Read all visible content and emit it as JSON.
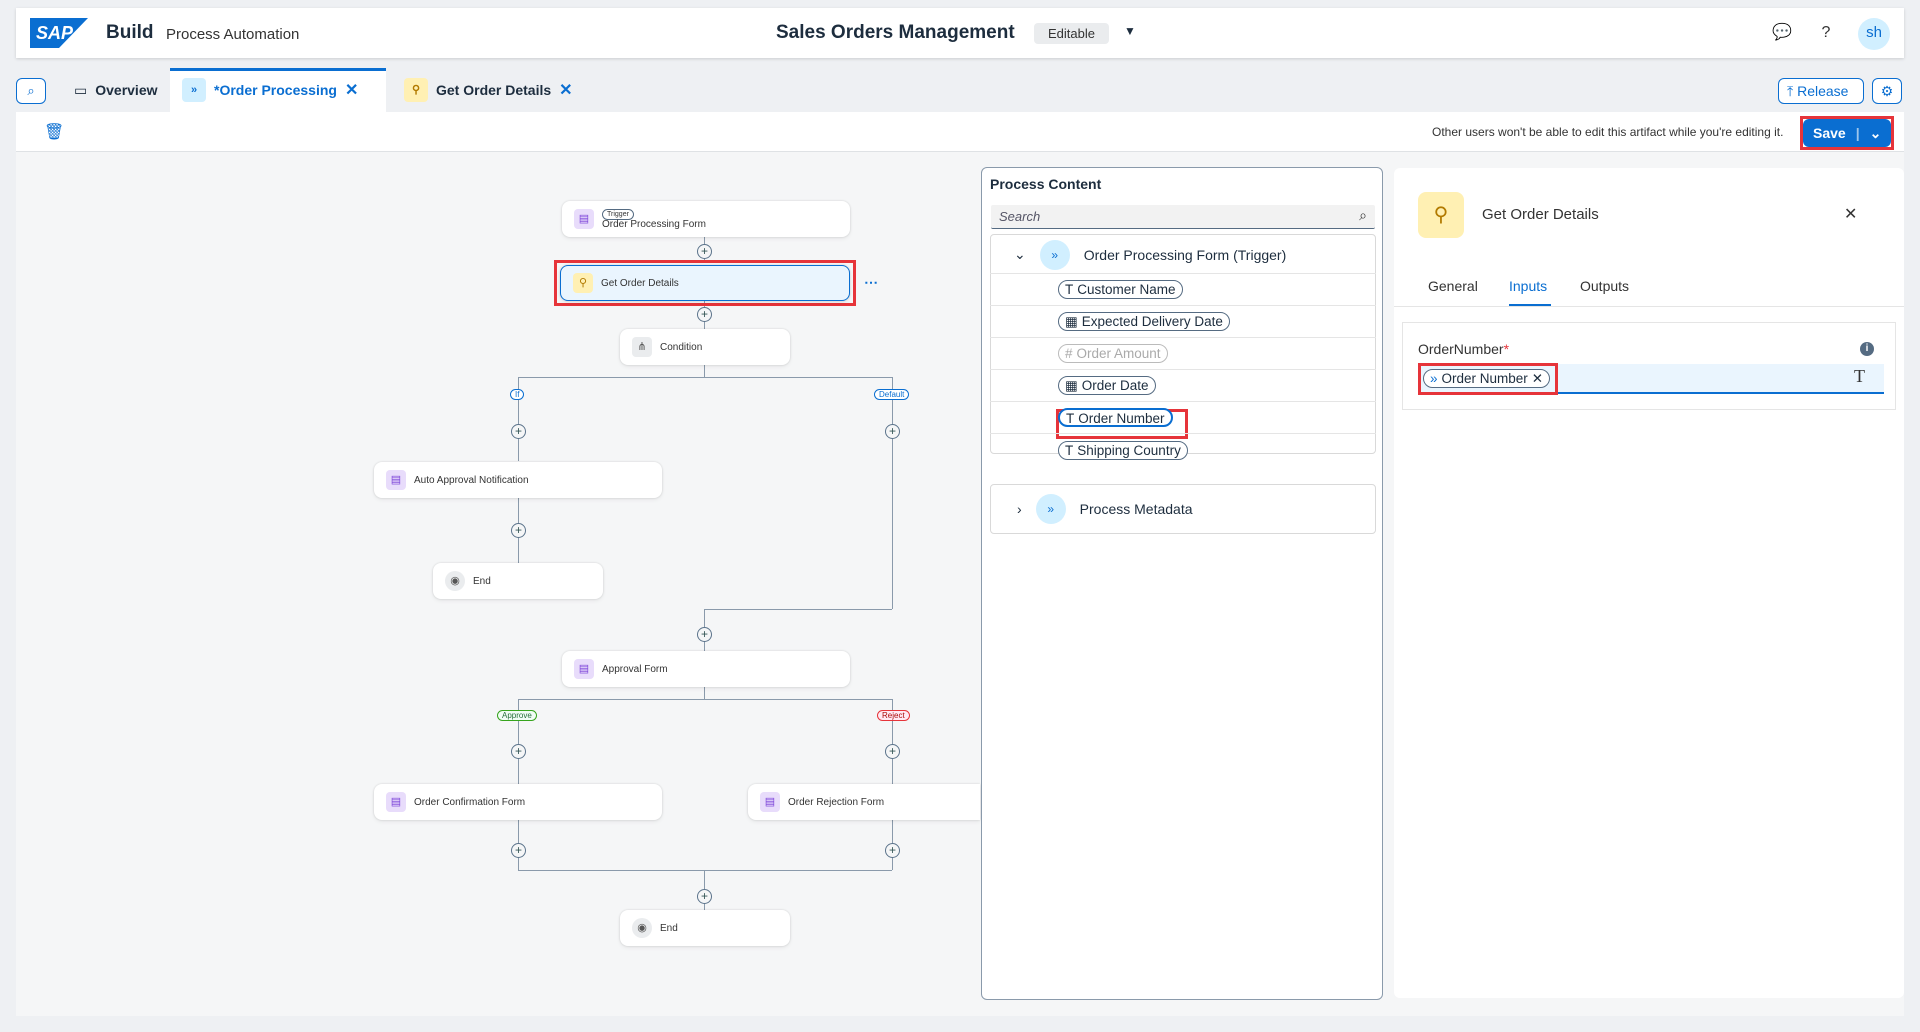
{
  "shell": {
    "logo": "SAP",
    "product": "Build",
    "subtitle": "Process Automation",
    "project": "Sales Orders Management",
    "status": "Editable",
    "avatar": "sh"
  },
  "tabs": [
    {
      "label": "Overview"
    },
    {
      "label": "*Order Processing"
    },
    {
      "label": "Get Order Details"
    }
  ],
  "actions": {
    "release": "Release",
    "save": "Save"
  },
  "toolbar": {
    "hint": "Other users won't be able to edit this artifact while you're editing it."
  },
  "canvas": {
    "trigger_badge": "Trigger",
    "trigger": "Order Processing Form",
    "get_order": "Get Order Details",
    "condition": "Condition",
    "if": "If",
    "default": "Default",
    "auto_approval": "Auto Approval Notification",
    "end1": "End",
    "approval_form": "Approval Form",
    "approve": "Approve",
    "reject": "Reject",
    "confirmation": "Order Confirmation Form",
    "rejection": "Order Rejection Form",
    "end2": "End"
  },
  "process_content": {
    "title": "Process Content",
    "search_placeholder": "Search",
    "group1": "Order Processing Form (Trigger)",
    "fields": [
      {
        "label": "Customer Name",
        "type": "T"
      },
      {
        "label": "Expected Delivery Date",
        "type": "▦"
      },
      {
        "label": "Order Amount",
        "type": "#"
      },
      {
        "label": "Order Date",
        "type": "▦"
      },
      {
        "label": "Order Number",
        "type": "T"
      },
      {
        "label": "Shipping Country",
        "type": "T"
      }
    ],
    "group2": "Process Metadata"
  },
  "details": {
    "title": "Get Order Details",
    "tabs": [
      "General",
      "Inputs",
      "Outputs"
    ],
    "field_label": "OrderNumber",
    "required": "*",
    "token": "Order Number"
  },
  "colors": {
    "accent": "#0a6ed1",
    "highlight": "#e6343a"
  }
}
